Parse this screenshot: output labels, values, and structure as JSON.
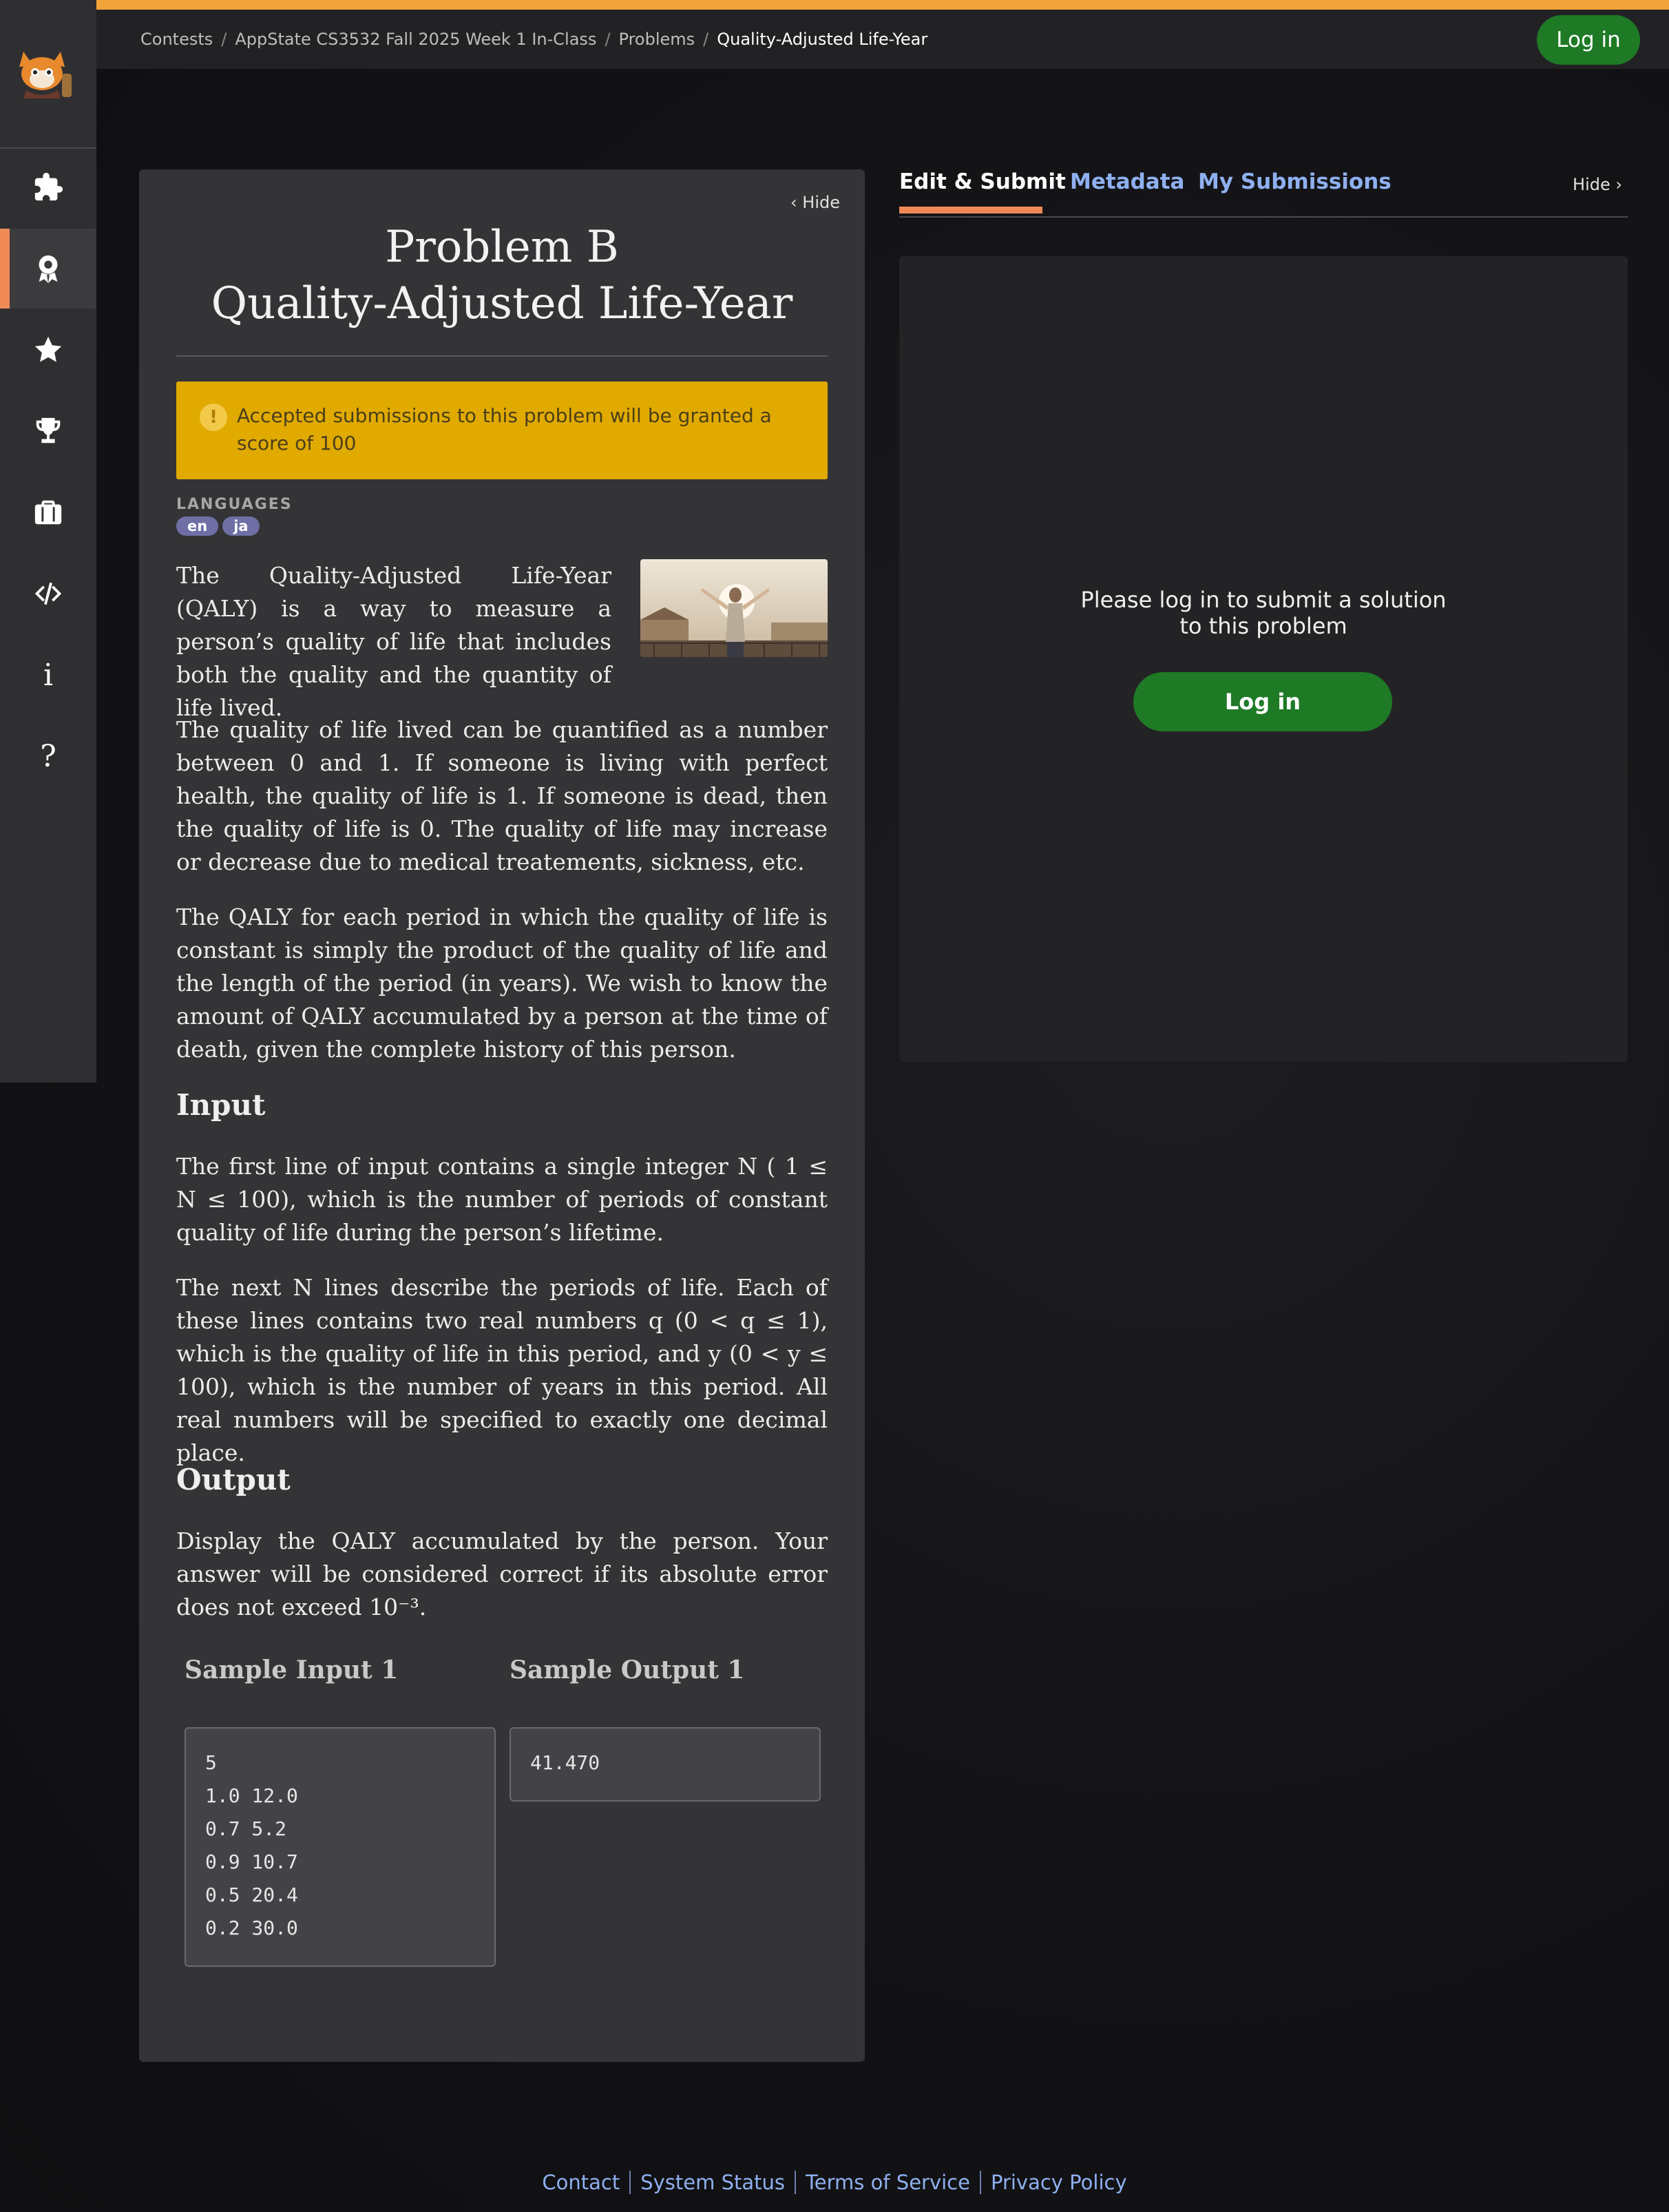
{
  "breadcrumb": {
    "items": [
      "Contests",
      "AppState CS3532 Fall 2025 Week 1 In-Class",
      "Problems"
    ],
    "current": "Quality-Adjusted Life-Year"
  },
  "header": {
    "login_label": "Log in"
  },
  "sidebar": {
    "icons": [
      "puzzle-icon",
      "badge-icon",
      "star-icon",
      "trophy-icon",
      "briefcase-icon",
      "code-icon",
      "info-icon",
      "help-icon"
    ],
    "active": "badge-icon"
  },
  "problem": {
    "hide_label": "Hide",
    "title_line1": "Problem B",
    "title_line2": "Quality-Adjusted Life-Year",
    "alert_text": "Accepted submissions to this problem will be granted a score of 100",
    "languages_label": "LANGUAGES",
    "languages": [
      "en",
      "ja"
    ],
    "para1": "The Quality-Adjusted Life-Year (QALY) is a way to measure a person’s quality of life that includes both the quality and the quantity of life lived.",
    "para2": "The quality of life lived can be quantified as a number between 0 and 1. If someone is living with perfect health, the quality of life is 1. If someone is dead, then the quality of life is 0. The quality of life may increase or decrease due to medical treatements, sickness, etc.",
    "para3": "The QALY for each period in which the quality of life is constant is simply the product of the quality of life and the length of the period (in years). We wish to know the amount of QALY accumulated by a person at the time of death, given the complete history of this person.",
    "input_heading": "Input",
    "input_para1": "The first line of input contains a single integer N ( 1 ≤ N ≤ 100), which is the number of periods of constant quality of life during the person’s lifetime.",
    "input_para2": "The next N lines describe the periods of life. Each of these lines contains two real numbers q (0 < q ≤ 1), which is the quality of life in this period, and y (0 < y ≤ 100), which is the number of years in this period. All real numbers will be specified to exactly one decimal place.",
    "output_heading": "Output",
    "output_para": "Display the QALY accumulated by the person. Your answer will be considered correct if its absolute error does not exceed 10⁻³.",
    "sample_input_heading": "Sample Input 1",
    "sample_output_heading": "Sample Output 1",
    "sample_input": "5\n1.0 12.0\n0.7 5.2\n0.9 10.7\n0.5 20.4\n0.2 30.0",
    "sample_output": "41.470"
  },
  "right_panel": {
    "tabs": [
      "Edit & Submit",
      "Metadata",
      "My Submissions"
    ],
    "active_tab": "Edit & Submit",
    "hide_label": "Hide",
    "login_message": "Please log in to submit a solution to this problem",
    "login_button": "Log in"
  },
  "footer": {
    "links": [
      "Contact",
      "System Status",
      "Terms of Service",
      "Privacy Policy"
    ]
  },
  "colors": {
    "accent_orange": "#f2a33a",
    "tab_underline": "#ef8a57",
    "login_green": "#1f7a26",
    "alert_yellow": "#e1aa00",
    "link_blue": "#8fb0f0"
  }
}
